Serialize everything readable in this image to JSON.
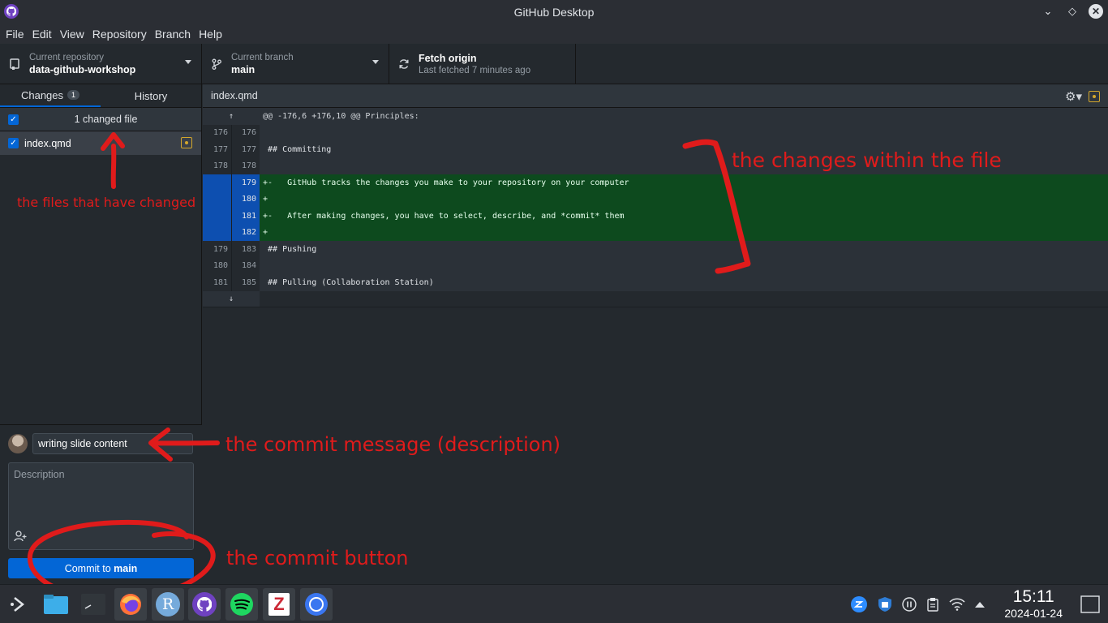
{
  "window": {
    "title": "GitHub Desktop"
  },
  "menu": [
    "File",
    "Edit",
    "View",
    "Repository",
    "Branch",
    "Help"
  ],
  "toolbar": {
    "repo_label": "Current repository",
    "repo_value": "data-github-workshop",
    "branch_label": "Current branch",
    "branch_value": "main",
    "fetch_label": "Fetch origin",
    "fetch_sub": "Last fetched 7 minutes ago"
  },
  "sidebar": {
    "tab_changes": "Changes",
    "tab_changes_count": "1",
    "tab_history": "History",
    "changes_header": "1 changed file",
    "file_name": "index.qmd"
  },
  "commit": {
    "summary": "writing slide content",
    "description_placeholder": "Description",
    "button_prefix": "Commit to ",
    "button_branch": "main"
  },
  "diff": {
    "file": "index.qmd",
    "hunk_header": "@@ -176,6 +176,10 @@ Principles:",
    "lines": [
      {
        "type": "ctx",
        "old": "176",
        "new": "176",
        "text": ""
      },
      {
        "type": "ctx",
        "old": "177",
        "new": "177",
        "text": " ## Committing"
      },
      {
        "type": "ctx",
        "old": "178",
        "new": "178",
        "text": ""
      },
      {
        "type": "add",
        "old": "",
        "new": "179",
        "text": "+-   GitHub tracks the changes you make to your repository on your computer"
      },
      {
        "type": "add",
        "old": "",
        "new": "180",
        "text": "+"
      },
      {
        "type": "add",
        "old": "",
        "new": "181",
        "text": "+-   After making changes, you have to select, describe, and *commit* them"
      },
      {
        "type": "add",
        "old": "",
        "new": "182",
        "text": "+"
      },
      {
        "type": "ctx",
        "old": "179",
        "new": "183",
        "text": " ## Pushing"
      },
      {
        "type": "ctx",
        "old": "180",
        "new": "184",
        "text": ""
      },
      {
        "type": "ctx",
        "old": "181",
        "new": "185",
        "text": " ## Pulling (Collaboration Station)"
      }
    ]
  },
  "annotations": {
    "files_changed": "the files that have changed",
    "changes_within": "the changes within the file",
    "commit_message": "the commit message (description)",
    "commit_button": "the commit button",
    "color": "#e01b1b"
  },
  "taskbar": {
    "apps": [
      "app-launcher-icon",
      "file-manager-icon",
      "terminal-icon",
      "firefox-icon",
      "rstudio-icon",
      "github-desktop-icon",
      "spotify-icon",
      "zotero-icon",
      "signal-icon"
    ],
    "rstudio_letter": "R",
    "zotero_letter": "Z",
    "time": "15:11",
    "date": "2024-01-24"
  }
}
